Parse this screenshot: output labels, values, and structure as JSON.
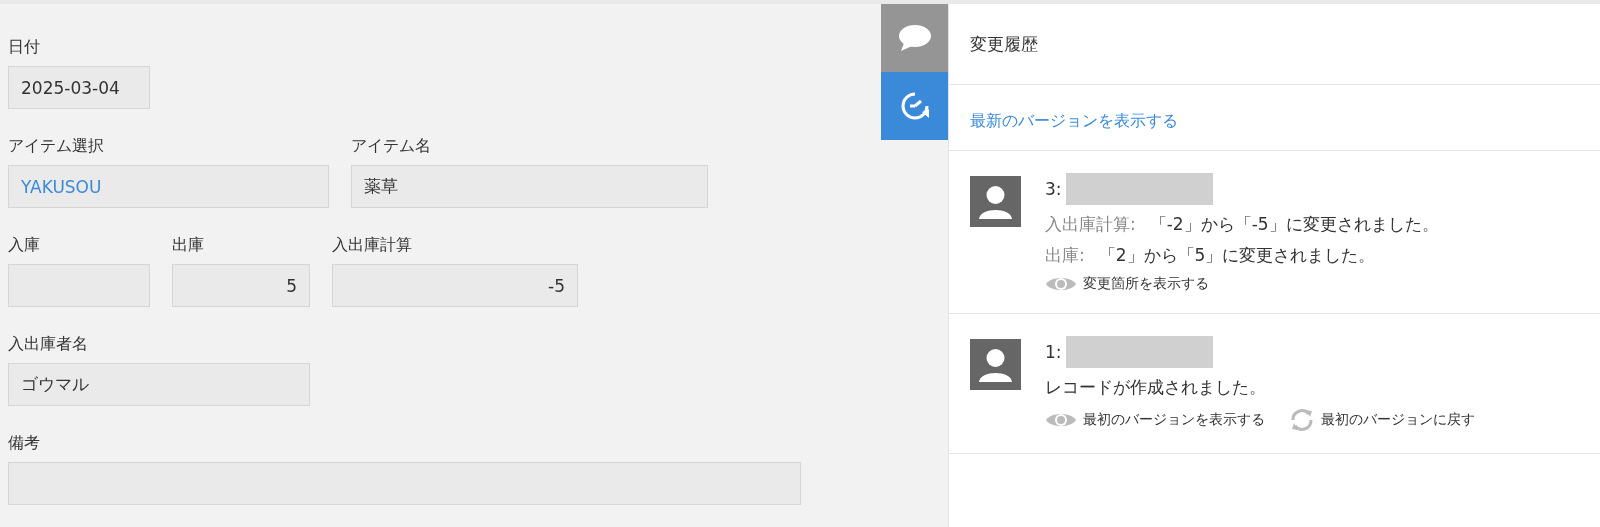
{
  "form": {
    "rows": [
      {
        "fields": [
          {
            "label": "日付",
            "value": "2025-03-04",
            "kind": "text"
          }
        ]
      },
      {
        "fields": [
          {
            "label": "アイテム選択",
            "value": "YAKUSOU",
            "kind": "link"
          },
          {
            "label": "アイテム名",
            "value": "薬草",
            "kind": "text"
          }
        ]
      },
      {
        "fields": [
          {
            "label": "入庫",
            "kind": "number"
          },
          {
            "label": "出庫",
            "value": "5",
            "kind": "number"
          },
          {
            "label": "入出庫計算",
            "value": "-5",
            "kind": "number"
          }
        ]
      },
      {
        "fields": [
          {
            "label": "入出庫者名",
            "value": "ゴウマル",
            "kind": "text"
          }
        ]
      },
      {
        "fields": [
          {
            "label": "備考",
            "kind": "text"
          }
        ]
      }
    ]
  },
  "side_tabs": [
    {
      "kind": "comments",
      "selected": false
    },
    {
      "kind": "history",
      "selected": true
    }
  ],
  "history": {
    "title": "変更履歴",
    "latest_link": "最新のバージョンを表示する",
    "entries": [
      {
        "number": "3:",
        "changes": [
          {
            "field": "入出庫計算:",
            "text": "「-2」から「-5」に変更されました。"
          },
          {
            "field": "出庫:",
            "text": "「2」から「5」に変更されました。"
          }
        ],
        "actions": [
          {
            "kind": "view",
            "label": "変更箇所を表示する"
          }
        ]
      },
      {
        "number": "1:",
        "message": "レコードが作成されました。",
        "actions": [
          {
            "kind": "view",
            "label": "最初のバージョンを表示する"
          },
          {
            "kind": "revert",
            "label": "最初のバージョンに戻す"
          }
        ]
      }
    ]
  }
}
